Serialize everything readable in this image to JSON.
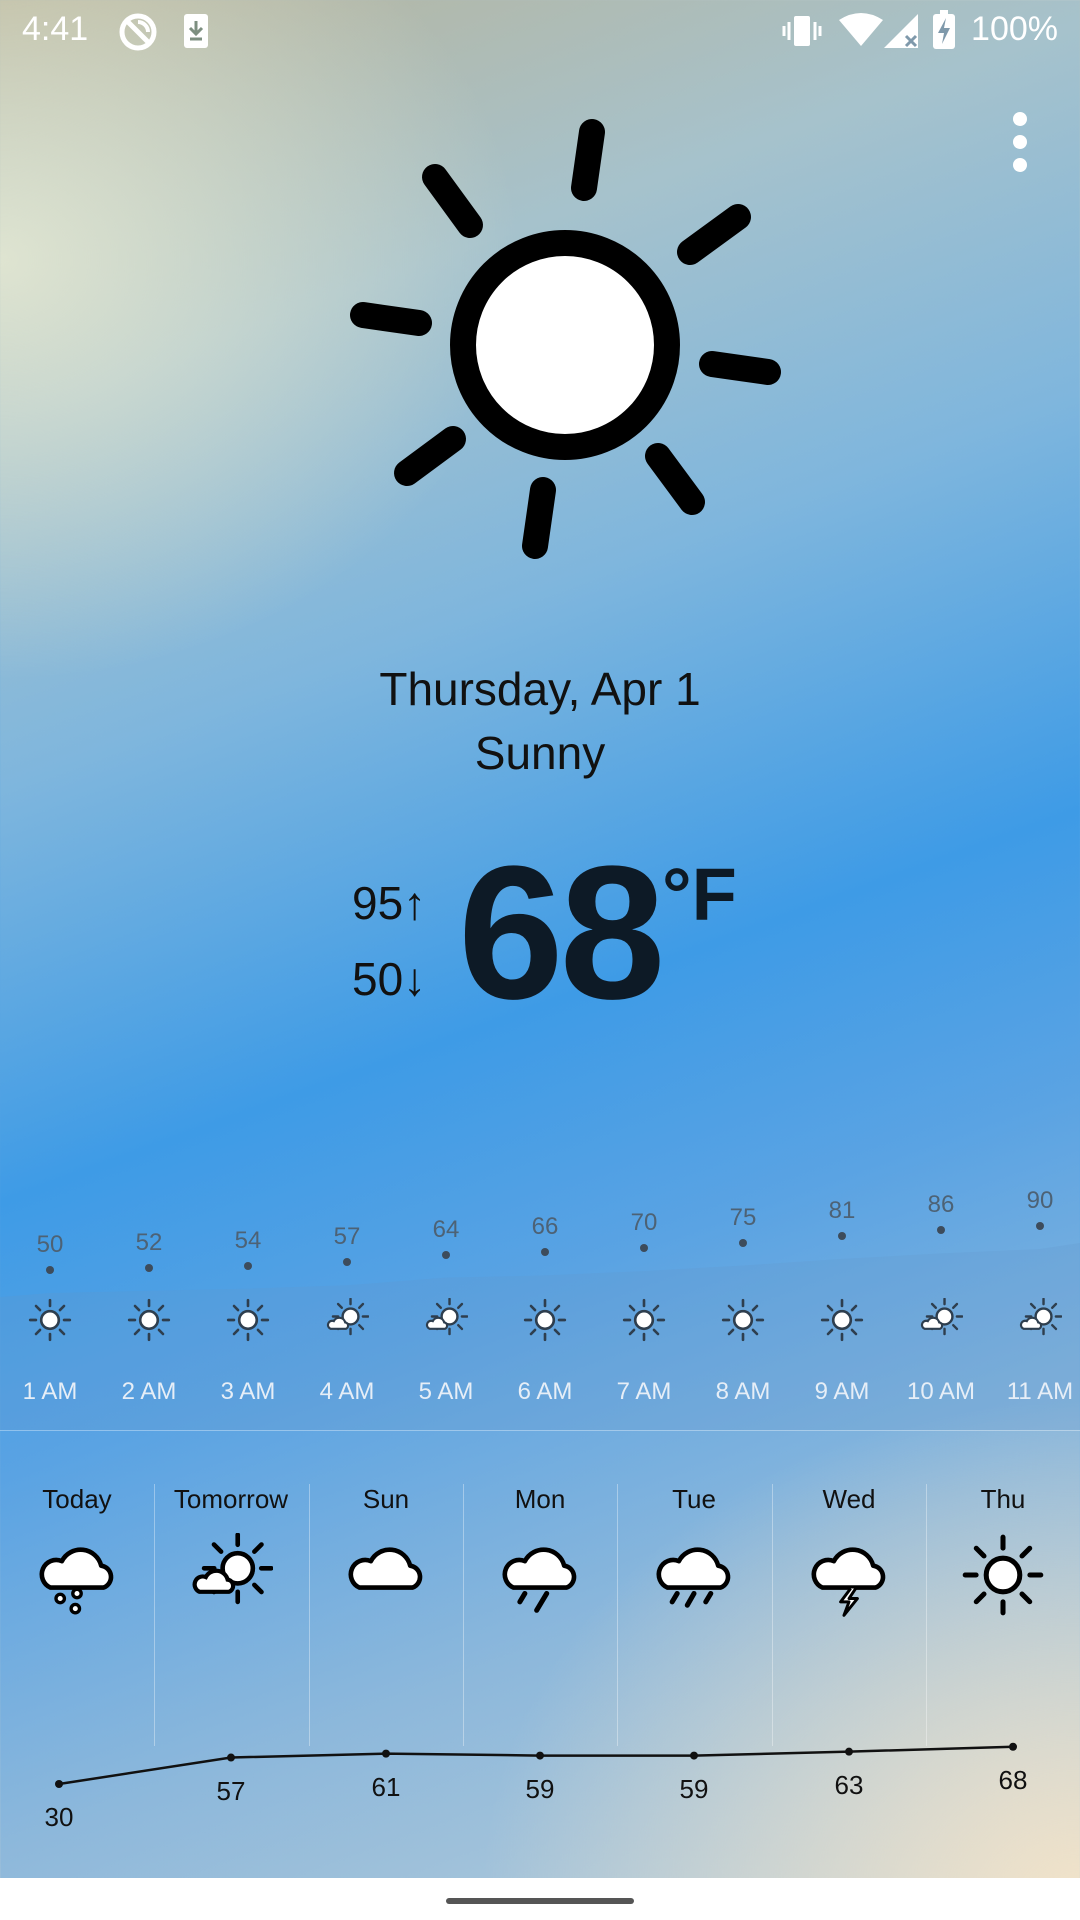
{
  "status_bar": {
    "time": "4:41",
    "battery_text": "100%",
    "icons": [
      "do-not-disturb-icon",
      "download-icon",
      "vibrate-icon",
      "wifi-icon",
      "signal-icon",
      "battery-charging-icon"
    ]
  },
  "menu": {
    "icon": "more-vert-icon"
  },
  "current": {
    "icon": "sun-icon",
    "date": "Thursday, Apr 1",
    "condition": "Sunny",
    "high": "95",
    "low": "50",
    "high_arrow": "↑",
    "low_arrow": "↓",
    "temperature": "68",
    "unit": "°F"
  },
  "hourly": [
    {
      "time": "1 AM",
      "temp": "50",
      "icon": "sun-icon"
    },
    {
      "time": "2 AM",
      "temp": "52",
      "icon": "sun-icon"
    },
    {
      "time": "3 AM",
      "temp": "54",
      "icon": "sun-icon"
    },
    {
      "time": "4 AM",
      "temp": "57",
      "icon": "partly-cloudy-icon"
    },
    {
      "time": "5 AM",
      "temp": "64",
      "icon": "partly-cloudy-icon"
    },
    {
      "time": "6 AM",
      "temp": "66",
      "icon": "sun-icon"
    },
    {
      "time": "7 AM",
      "temp": "70",
      "icon": "sun-icon"
    },
    {
      "time": "8 AM",
      "temp": "75",
      "icon": "sun-icon"
    },
    {
      "time": "9 AM",
      "temp": "81",
      "icon": "sun-icon"
    },
    {
      "time": "10 AM",
      "temp": "86",
      "icon": "partly-cloudy-icon"
    },
    {
      "time": "11 AM",
      "temp": "90",
      "icon": "partly-cloudy-icon"
    }
  ],
  "daily": [
    {
      "day": "Today",
      "temp": "30",
      "icon": "snow-icon"
    },
    {
      "day": "Tomorrow",
      "temp": "57",
      "icon": "partly-cloudy-icon"
    },
    {
      "day": "Sun",
      "temp": "61",
      "icon": "cloud-icon"
    },
    {
      "day": "Mon",
      "temp": "59",
      "icon": "rain-icon"
    },
    {
      "day": "Tue",
      "temp": "59",
      "icon": "heavy-rain-icon"
    },
    {
      "day": "Wed",
      "temp": "63",
      "icon": "thunderstorm-icon"
    },
    {
      "day": "Thu",
      "temp": "68",
      "icon": "sun-icon"
    }
  ]
}
